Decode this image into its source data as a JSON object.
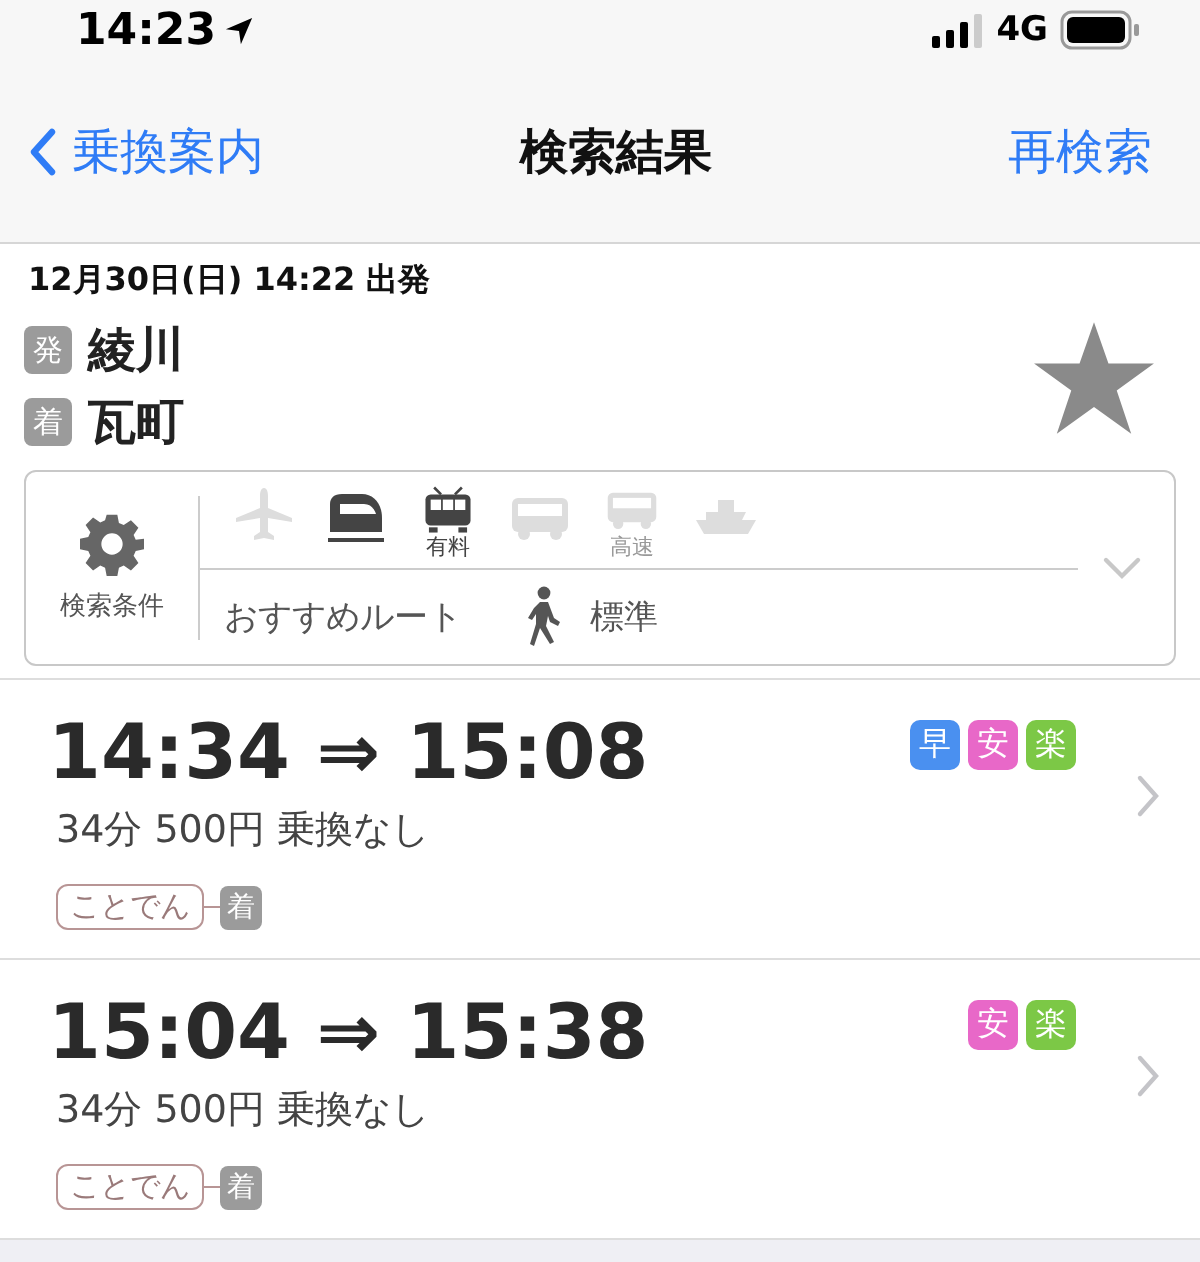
{
  "status_bar": {
    "time": "14:23",
    "network": "4G"
  },
  "nav": {
    "back": "乗換案内",
    "title": "検索結果",
    "action": "再検索"
  },
  "search": {
    "departure_time": "12月30日(日) 14:22 出発",
    "from_tag": "発",
    "from": "綾川",
    "to_tag": "着",
    "to": "瓦町",
    "favorite": false
  },
  "conditions": {
    "label": "検索条件",
    "modes": [
      {
        "kind": "plane",
        "on": false
      },
      {
        "kind": "shinkansen",
        "on": true
      },
      {
        "kind": "express",
        "on": true,
        "label": "有料"
      },
      {
        "kind": "bus",
        "on": false
      },
      {
        "kind": "highway_bus",
        "on": false,
        "label": "高速"
      },
      {
        "kind": "ferry",
        "on": false
      }
    ],
    "sort": "おすすめルート",
    "walk_speed": "標準"
  },
  "routes": [
    {
      "times": "14:34 ⇒ 15:08",
      "summary": "34分 500円 乗換なし",
      "badges": [
        {
          "text": "早",
          "color": "#4a90f0"
        },
        {
          "text": "安",
          "color": "#e868c8"
        },
        {
          "text": "楽",
          "color": "#7cc846"
        }
      ],
      "line": "ことでん",
      "end_tag": "着"
    },
    {
      "times": "15:04 ⇒ 15:38",
      "summary": "34分 500円 乗換なし",
      "badges": [
        {
          "text": "安",
          "color": "#e868c8"
        },
        {
          "text": "楽",
          "color": "#7cc846"
        }
      ],
      "line": "ことでん",
      "end_tag": "着"
    }
  ]
}
